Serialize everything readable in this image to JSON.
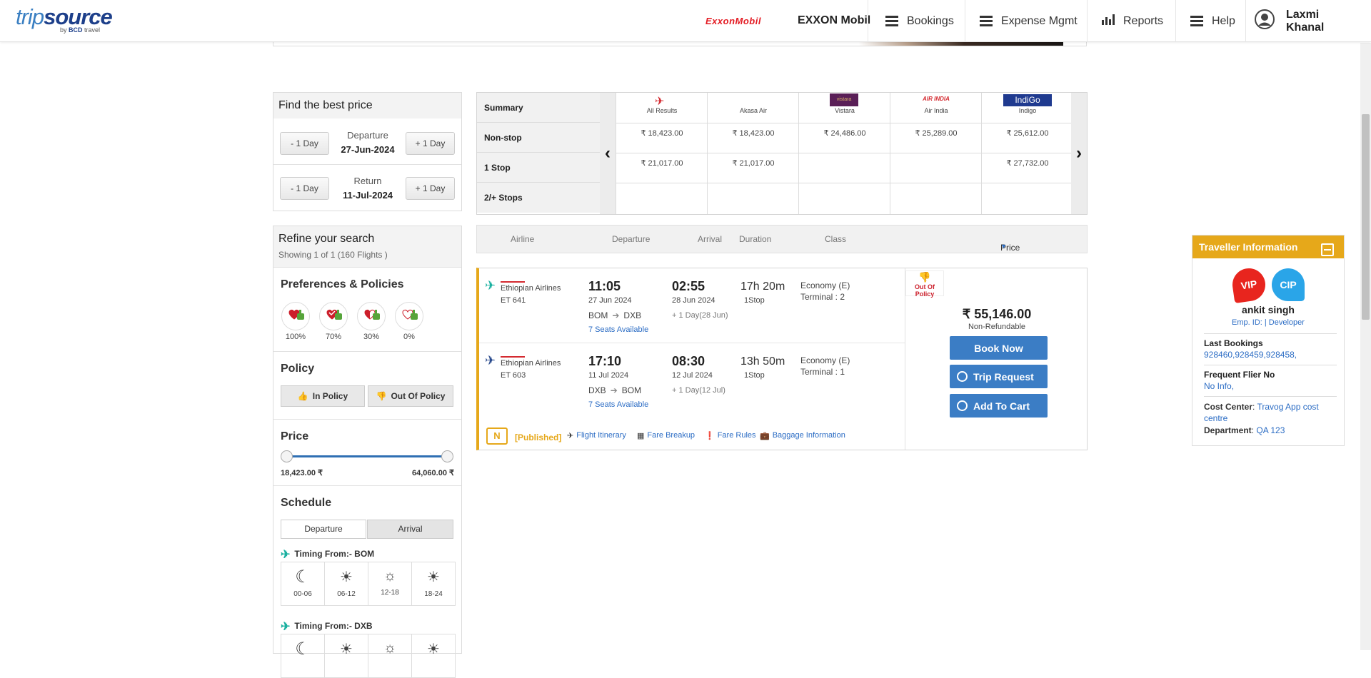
{
  "header": {
    "logo_main": "trip",
    "logo_bold": "source",
    "logo_by": "by",
    "logo_bcd": "BCD",
    "logo_travel": "travel",
    "company_logo": "ExxonMobil",
    "company_name": "EXXON Mobil",
    "nav": [
      "Bookings",
      "Expense Mgmt",
      "Reports",
      "Help"
    ],
    "user_name": "Laxmi Khanal"
  },
  "find_price": {
    "title": "Find the best price",
    "minus_label": "- 1 Day",
    "plus_label": "+ 1 Day",
    "departure_label": "Departure",
    "departure_date": "27-Jun-2024",
    "return_label": "Return",
    "return_date": "11-Jul-2024"
  },
  "refine": {
    "title": "Refine your search",
    "showing": "Showing 1 of 1 (160 Flights )",
    "preferences_title": "Preferences & Policies",
    "preferences": [
      "100%",
      "70%",
      "30%",
      "0%"
    ],
    "policy_title": "Policy",
    "in_policy": "In Policy",
    "out_policy": "Out Of Policy",
    "price_title": "Price",
    "price_min": "18,423.00 ₹",
    "price_max": "64,060.00 ₹",
    "schedule_title": "Schedule",
    "schedule_tabs": [
      "Departure",
      "Arrival"
    ],
    "timing_from_1": "Timing From:- BOM",
    "timing_from_2": "Timing From:- DXB",
    "time_slots": [
      "00-06",
      "06-12",
      "12-18",
      "18-24"
    ]
  },
  "summary": {
    "rows": [
      "Summary",
      "Non-stop",
      "1 Stop",
      "2/+ Stops"
    ],
    "airlines": [
      "All Results",
      "Akasa Air",
      "Vistara",
      "Air India",
      "Indigo"
    ],
    "logo_text": {
      "vistara": "vistara",
      "airindia": "AIR INDIA",
      "indigo": "IndiGo"
    },
    "nonstop": [
      "₹ 18,423.00",
      "₹ 18,423.00",
      "₹ 24,486.00",
      "₹ 25,289.00",
      "₹ 25,612.00"
    ],
    "one_stop": [
      "₹ 21,017.00",
      "₹ 21,017.00",
      "",
      "",
      "₹ 27,732.00"
    ],
    "prev_arrow": "‹",
    "next_arrow": "›"
  },
  "result_header": {
    "airline": "Airline",
    "departure": "Departure",
    "arrival": "Arrival",
    "duration": "Duration",
    "class": "Class",
    "price": "Price"
  },
  "flight": {
    "segments": [
      {
        "airline": "Ethiopian Airlines",
        "flight_no": "ET  641",
        "dep_time": "11:05",
        "dep_date": "27 Jun 2024",
        "arr_time": "02:55",
        "arr_date": "28 Jun 2024",
        "from": "BOM",
        "to": "DXB",
        "next_day": "+ 1 Day(28 Jun)",
        "seats": "7 Seats Available",
        "duration": "17h 20m",
        "stops": "1Stop",
        "class": "Economy (E)",
        "terminal": "Terminal : 2"
      },
      {
        "airline": "Ethiopian Airlines",
        "flight_no": "ET  603",
        "dep_time": "17:10",
        "dep_date": "11 Jul 2024",
        "arr_time": "08:30",
        "arr_date": "12 Jul 2024",
        "from": "DXB",
        "to": "BOM",
        "next_day": "+ 1 Day(12 Jul)",
        "seats": "7 Seats Available",
        "duration": "13h 50m",
        "stops": "1Stop",
        "class": "Economy (E)",
        "terminal": "Terminal : 1"
      }
    ],
    "policy_badge": "Out Of Policy",
    "price": "₹ 55,146.00",
    "refund": "Non-Refundable",
    "book_now": "Book Now",
    "trip_request": "Trip Request",
    "add_to_cart": "Add To Cart",
    "fare_type_icon": "N",
    "fare_type": "[Published]",
    "links": [
      "Flight Itinerary",
      "Fare Breakup",
      "Fare Rules",
      "Baggage Information"
    ]
  },
  "traveller": {
    "title": "Traveller Information",
    "badges": [
      "VIP",
      "CIP"
    ],
    "name": "ankit singh",
    "emp": "Emp. ID: | Developer",
    "last_bookings_label": "Last Bookings",
    "last_bookings": "928460,928459,928458,",
    "ff_label": "Frequent Flier No",
    "ff_value": "No Info,",
    "cost_center_label": "Cost Center",
    "cost_center_1": "Travog App cost",
    "cost_center_2": "centre",
    "department_label": "Department",
    "department": "QA 123"
  }
}
